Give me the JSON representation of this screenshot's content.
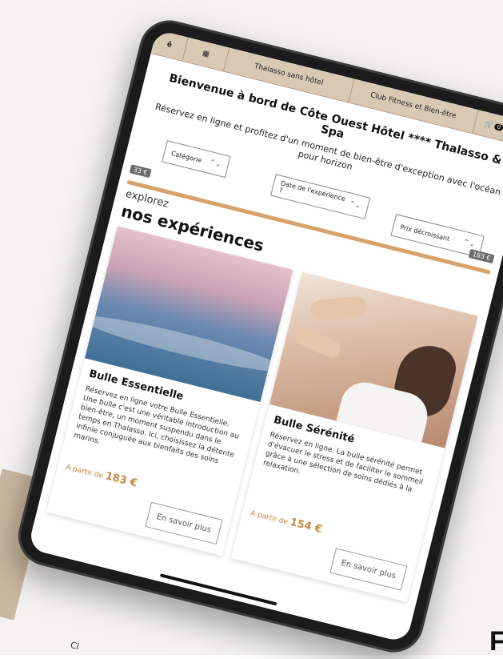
{
  "nav": {
    "logo": "ê",
    "tab1": "Thalasso sans hôtel",
    "tab2": "Club Fitness et Bien-être",
    "cart_count": "0"
  },
  "hero": {
    "title": "Bienvenue à bord de Côte Ouest Hôtel **** Thalasso & Spa",
    "subtitle": "Réservez en ligne et profitez d'un moment de bien-être d'exception avec l'océan pour horizon"
  },
  "filters": {
    "category": "Catégorie",
    "date": "Date de l'expérience ?",
    "sort": "Prix décroissant",
    "price_min": "33 €",
    "price_max": "183 €"
  },
  "explore": {
    "sub": "explorez",
    "title": "nos expériences"
  },
  "cards": [
    {
      "title": "Bulle Essentielle",
      "description": "Réservez en ligne votre Bulle Essentielle. Une bulle c'est une véritable introduction au bien-être, un moment suspendu dans le temps en Thalasso. Ici, choisissez la détente infinie conjuguée aux bienfaits des soins marins.",
      "price_prefix": "A partir de",
      "price": "183 €",
      "cta": "En savoir plus"
    },
    {
      "title": "Bulle Sérénité",
      "description": "Réservez en ligne. La bulle sérénité permet d'évacuer le stress et de faciliter le sommeil grâce à une sélection de soins dédiés à la relaxation.",
      "price_prefix": "A partir de",
      "price": "154 €",
      "cta": "En savoir plus"
    }
  ],
  "background": {
    "label": "Cl",
    "glyph": "F"
  },
  "colors": {
    "nav_bg": "#d8c9b3",
    "accent": "#d8a16a",
    "price": "#c8873f",
    "frame": "#1b1b1b"
  }
}
